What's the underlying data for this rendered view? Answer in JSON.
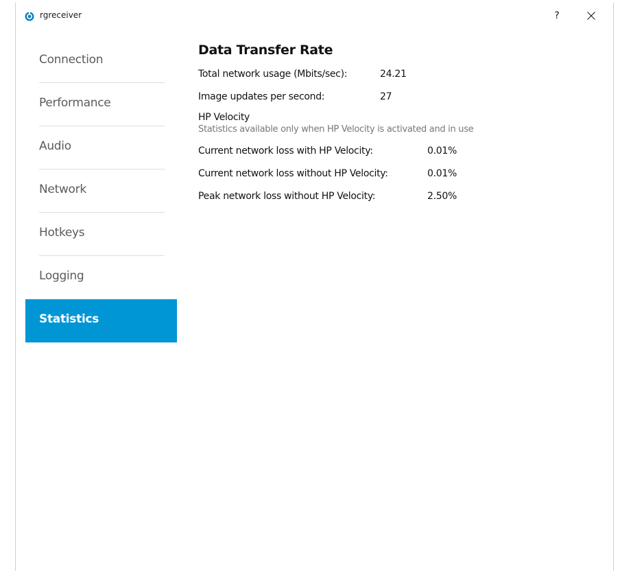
{
  "window": {
    "title": "rgreceiver",
    "help_label": "?"
  },
  "sidebar": {
    "items": [
      {
        "label": "Connection",
        "active": false
      },
      {
        "label": "Performance",
        "active": false
      },
      {
        "label": "Audio",
        "active": false
      },
      {
        "label": "Network",
        "active": false
      },
      {
        "label": "Hotkeys",
        "active": false
      },
      {
        "label": "Logging",
        "active": false
      },
      {
        "label": "Statistics",
        "active": true
      }
    ]
  },
  "main": {
    "title": "Data Transfer Rate",
    "rows": [
      {
        "label": "Total network usage (Mbits/sec):",
        "value": "24.21"
      },
      {
        "label": "Image updates per second:",
        "value": "27"
      }
    ],
    "velocity": {
      "heading": "HP Velocity",
      "note": "Statistics available only when HP Velocity is activated and in use",
      "rows": [
        {
          "label": "Current network loss with HP Velocity:",
          "value": "0.01%"
        },
        {
          "label": "Current network loss without HP Velocity:",
          "value": "0.01%"
        },
        {
          "label": "Peak network loss without HP Velocity:",
          "value": "2.50%"
        }
      ]
    }
  },
  "colors": {
    "accent": "#0096d6",
    "nav_text": "#5b5b5b",
    "note_text": "#777777"
  },
  "icons": {
    "app": "rgreceiver-app-icon",
    "close": "close-icon"
  }
}
